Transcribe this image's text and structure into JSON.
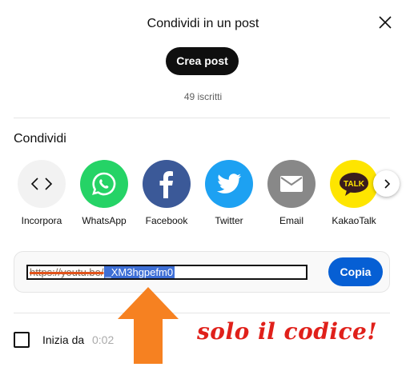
{
  "dialog": {
    "title": "Condividi in un post",
    "create_post_label": "Crea post",
    "subscribers": "49 iscritti"
  },
  "share": {
    "section_label": "Condividi",
    "items": [
      {
        "label": "Incorpora",
        "icon": "embed-code-icon",
        "color": "#f2f2f2"
      },
      {
        "label": "WhatsApp",
        "icon": "whatsapp-icon",
        "color": "#25d366"
      },
      {
        "label": "Facebook",
        "icon": "facebook-icon",
        "color": "#3b5998"
      },
      {
        "label": "Twitter",
        "icon": "twitter-icon",
        "color": "#1da1f2"
      },
      {
        "label": "Email",
        "icon": "email-icon",
        "color": "#888888"
      },
      {
        "label": "KakaoTalk",
        "icon": "kakaotalk-icon",
        "color": "#fee500"
      }
    ],
    "next_icon": "chevron-right-icon"
  },
  "link": {
    "url_prefix": "https://youtu.be/",
    "video_code": "_XM3hgpefm0",
    "copy_label": "Copia"
  },
  "start": {
    "label": "Inizia da",
    "time": "0:02"
  },
  "annotation": {
    "text": "solo il codice!",
    "arrow_color": "#f68121",
    "text_color": "#e0201a"
  }
}
